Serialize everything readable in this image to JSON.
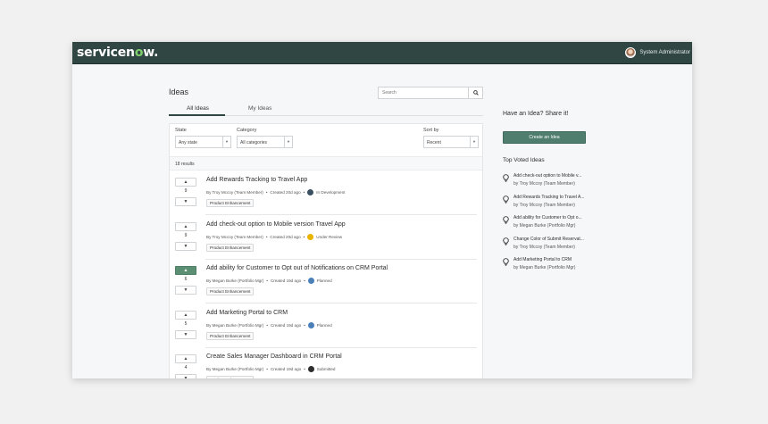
{
  "app": {
    "logo_text_a": "servicen",
    "logo_text_o": "o",
    "logo_text_b": "w.",
    "user_name": "System Administrator"
  },
  "page": {
    "title": "Ideas",
    "search_placeholder": "Search",
    "tabs": [
      "All Ideas",
      "My Ideas"
    ]
  },
  "filters": {
    "state": {
      "label": "State",
      "value": "Any state"
    },
    "category": {
      "label": "Category",
      "value": "All categories"
    },
    "sort": {
      "label": "Sort by",
      "value": "Recent"
    }
  },
  "results_text": "18 results",
  "ideas": [
    {
      "votes": "9",
      "voted": false,
      "title": "Add Rewards Tracking to Travel App",
      "author": "By Troy Mccoy (Team Member)",
      "created": "Created 20d ago",
      "status": "In Development",
      "status_color": "#3b4f63",
      "tag": "Product Enhancement"
    },
    {
      "votes": "9",
      "voted": false,
      "title": "Add check-out option to Mobile version Travel App",
      "author": "By Troy Mccoy (Team Member)",
      "created": "Created 20d ago",
      "status": "Under Review",
      "status_color": "#e8b400",
      "tag": "Product Enhancement"
    },
    {
      "votes": "6",
      "voted": true,
      "title": "Add ability for Customer to Opt out of Notifications on CRM Portal",
      "author": "By Megan Burke (Portfolio Mgr)",
      "created": "Created 19d ago",
      "status": "Planned",
      "status_color": "#4a7fb8",
      "tag": "Product Enhancement"
    },
    {
      "votes": "5",
      "voted": false,
      "title": "Add Marketing Portal to CRM",
      "author": "By Megan Burke (Portfolio Mgr)",
      "created": "Created 19d ago",
      "status": "Planned",
      "status_color": "#4a7fb8",
      "tag": "Product Enhancement"
    },
    {
      "votes": "4",
      "voted": false,
      "title": "Create Sales Manager Dashboard in CRM Portal",
      "author": "By Megan Burke (Portfolio Mgr)",
      "created": "Created 19d ago",
      "status": "Submitted",
      "status_color": "#2e2e2e",
      "tag": "Product Enhancement"
    }
  ],
  "sidebar": {
    "share_title": "Have an Idea? Share it!",
    "create_button": "Create an Idea",
    "top_voted_title": "Top Voted Ideas",
    "top_voted": [
      {
        "title": "Add check-out option to Mobile v...",
        "by": "by Troy Mccoy (Team Member)"
      },
      {
        "title": "Add Rewards Tracking to Travel A...",
        "by": "by Troy Mccoy (Team Member)"
      },
      {
        "title": "Add ability for Customer to Opt o...",
        "by": "by Megan Burke (Portfolio Mgr)"
      },
      {
        "title": "Change Color of Submit Reservat...",
        "by": "by Troy Mccoy (Team Member)"
      },
      {
        "title": "Add Marketing Portal to CRM",
        "by": "by Megan Burke (Portfolio Mgr)"
      }
    ]
  }
}
